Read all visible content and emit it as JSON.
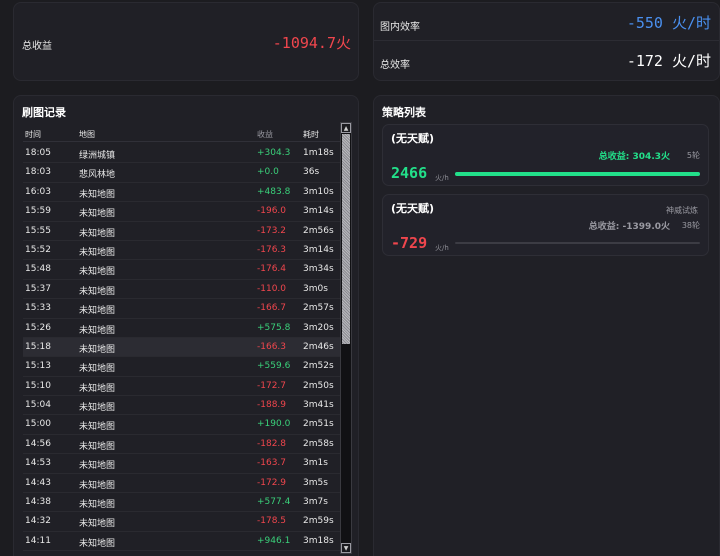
{
  "summary": {
    "total_income_label": "总收益",
    "total_income_value": "-1094.7火"
  },
  "efficiency": {
    "map_eff_label": "图内效率",
    "map_eff_value": "-550 火/时",
    "total_eff_label": "总效率",
    "total_eff_value": "-172 火/时"
  },
  "records": {
    "title": "刷图记录",
    "headers": {
      "time": "时间",
      "map": "地图",
      "gain": "收益",
      "duration": "耗时"
    },
    "rows": [
      {
        "time": "18:05",
        "map": "绿洲城镇",
        "gain": "+304.3",
        "duration": "1m18s",
        "sign": "pos"
      },
      {
        "time": "18:03",
        "map": "悲风林地",
        "gain": "+0.0",
        "duration": "36s",
        "sign": "pos"
      },
      {
        "time": "16:03",
        "map": "未知地图",
        "gain": "+483.8",
        "duration": "3m10s",
        "sign": "pos"
      },
      {
        "time": "15:59",
        "map": "未知地图",
        "gain": "-196.0",
        "duration": "3m14s",
        "sign": "neg"
      },
      {
        "time": "15:55",
        "map": "未知地图",
        "gain": "-173.2",
        "duration": "2m56s",
        "sign": "neg"
      },
      {
        "time": "15:52",
        "map": "未知地图",
        "gain": "-176.3",
        "duration": "3m14s",
        "sign": "neg"
      },
      {
        "time": "15:48",
        "map": "未知地图",
        "gain": "-176.4",
        "duration": "3m34s",
        "sign": "neg"
      },
      {
        "time": "15:37",
        "map": "未知地图",
        "gain": "-110.0",
        "duration": "3m0s",
        "sign": "neg"
      },
      {
        "time": "15:33",
        "map": "未知地图",
        "gain": "-166.7",
        "duration": "2m57s",
        "sign": "neg"
      },
      {
        "time": "15:26",
        "map": "未知地图",
        "gain": "+575.8",
        "duration": "3m20s",
        "sign": "pos"
      },
      {
        "time": "15:18",
        "map": "未知地图",
        "gain": "-166.3",
        "duration": "2m46s",
        "sign": "neg"
      },
      {
        "time": "15:13",
        "map": "未知地图",
        "gain": "+559.6",
        "duration": "2m52s",
        "sign": "pos"
      },
      {
        "time": "15:10",
        "map": "未知地图",
        "gain": "-172.7",
        "duration": "2m50s",
        "sign": "neg"
      },
      {
        "time": "15:04",
        "map": "未知地图",
        "gain": "-188.9",
        "duration": "3m41s",
        "sign": "neg"
      },
      {
        "time": "15:00",
        "map": "未知地图",
        "gain": "+190.0",
        "duration": "2m51s",
        "sign": "pos"
      },
      {
        "time": "14:56",
        "map": "未知地图",
        "gain": "-182.8",
        "duration": "2m58s",
        "sign": "neg"
      },
      {
        "time": "14:53",
        "map": "未知地图",
        "gain": "-163.7",
        "duration": "3m1s",
        "sign": "neg"
      },
      {
        "time": "14:43",
        "map": "未知地图",
        "gain": "-172.9",
        "duration": "3m5s",
        "sign": "neg"
      },
      {
        "time": "14:38",
        "map": "未知地图",
        "gain": "+577.4",
        "duration": "3m7s",
        "sign": "pos"
      },
      {
        "time": "14:32",
        "map": "未知地图",
        "gain": "-178.5",
        "duration": "2m59s",
        "sign": "neg"
      },
      {
        "time": "14:11",
        "map": "未知地图",
        "gain": "+946.1",
        "duration": "3m18s",
        "sign": "pos"
      }
    ],
    "selected_index": 10
  },
  "strategies": {
    "title": "策略列表",
    "items": [
      {
        "name": "(无天赋)",
        "tag": "",
        "income": "总收益: 304.3火",
        "rounds": "5轮",
        "efficiency": "2466",
        "unit": "火/h",
        "bar_fraction": 1.0,
        "color": "#22e08a"
      },
      {
        "name": "(无天赋)",
        "tag": "神威试炼",
        "income": "总收益: -1399.0火",
        "rounds": "38轮",
        "efficiency": "-729",
        "unit": "火/h",
        "bar_fraction": 0.0,
        "color": "#f0464d"
      }
    ]
  },
  "colors": {
    "positive": "#3ad07a",
    "negative": "#f0464d",
    "accent_blue": "#4a90f0",
    "strategy_green": "#22e08a"
  },
  "icons": {
    "scroll_up": "scroll-up-icon",
    "scroll_down": "scroll-down-icon"
  }
}
